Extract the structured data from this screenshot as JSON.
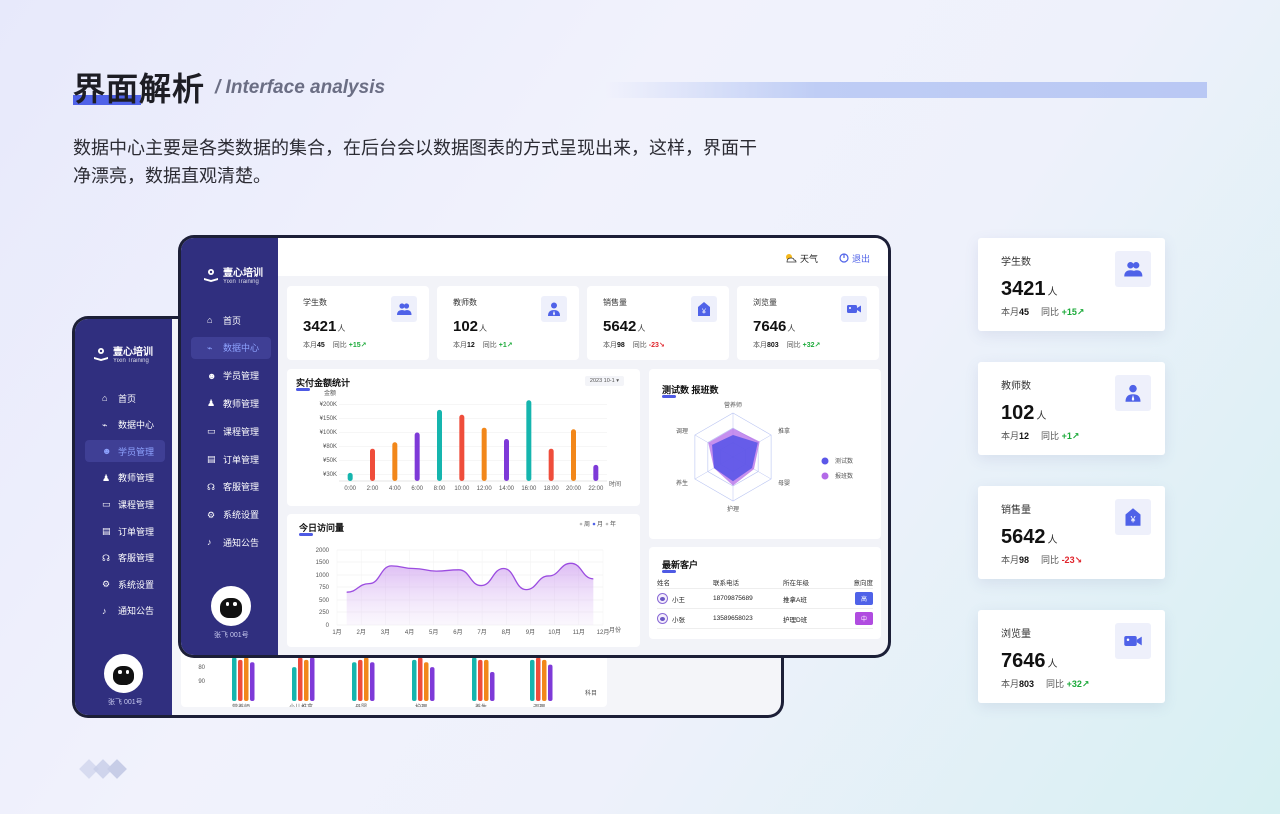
{
  "header": {
    "title": "界面解析",
    "subtitle": "/ Interface analysis",
    "description": "数据中心主要是各类数据的集合，在后台会以数据图表的方式呈现出来，这样，界面干净漂亮，数据直观清楚。"
  },
  "brand": {
    "name": "壹心培训",
    "name_en": "Yixin Training"
  },
  "nav": [
    "首页",
    "数据中心",
    "学员管理",
    "教师管理",
    "课程管理",
    "订单管理",
    "客服管理",
    "系统设置",
    "通知公告"
  ],
  "nav_active_front": 1,
  "nav_active_back": 2,
  "user": {
    "label": "张飞  001号"
  },
  "topbar": {
    "weather": "天气",
    "logout": "退出"
  },
  "metrics": [
    {
      "label": "学生数",
      "value": "3421",
      "unit": "人",
      "month_label": "本月",
      "month": "45",
      "yoy_label": "同比",
      "yoy": "+15",
      "trend": "up",
      "icon": "users-icon"
    },
    {
      "label": "教师数",
      "value": "102",
      "unit": "人",
      "month_label": "本月",
      "month": "12",
      "yoy_label": "同比",
      "yoy": "+1",
      "trend": "up",
      "icon": "teacher-icon"
    },
    {
      "label": "销售量",
      "value": "5642",
      "unit": "人",
      "month_label": "本月",
      "month": "98",
      "yoy_label": "同比",
      "yoy": "-23",
      "trend": "down",
      "icon": "sales-tag-icon"
    },
    {
      "label": "浏览量",
      "value": "7646",
      "unit": "人",
      "month_label": "本月",
      "month": "803",
      "yoy_label": "同比",
      "yoy": "+32",
      "trend": "up",
      "icon": "video-icon"
    }
  ],
  "colors": {
    "sidebar": "#302f7f",
    "accent": "#4f62e8",
    "up": "#1caa3a",
    "down": "#e0252c",
    "purple": "#9b4ce0"
  },
  "chart_data": [
    {
      "type": "bar",
      "title": "实付金额统计",
      "date_select": "2023 10-1",
      "ylabel": "金额",
      "xlabel": "时间",
      "yticks": [
        "¥30K",
        "¥50K",
        "¥80K",
        "¥100K",
        "¥150K",
        "¥200K"
      ],
      "categories": [
        "0:00",
        "2:00",
        "4:00",
        "6:00",
        "8:00",
        "10:00",
        "12:00",
        "14:00",
        "16:00",
        "18:00",
        "20:00",
        "22:00"
      ],
      "values": [
        0.5,
        2.0,
        2.4,
        3.0,
        4.4,
        4.1,
        3.3,
        2.6,
        5.0,
        2.0,
        3.2,
        1.0
      ],
      "bar_colors": [
        "#15b5ae",
        "#ef4d3b",
        "#f2871a",
        "#7e3ad8",
        "#15b5ae",
        "#ef4d3b",
        "#f2871a",
        "#7e3ad8",
        "#15b5ae",
        "#ef4d3b",
        "#f2871a",
        "#7e3ad8"
      ],
      "grid": true
    },
    {
      "type": "radar",
      "title": "测试数 报班数",
      "axes": [
        "营养师",
        "推拿",
        "母婴",
        "护理",
        "养生",
        "调理"
      ],
      "series": [
        {
          "name": "测试数",
          "values": [
            0.5,
            0.65,
            0.5,
            0.55,
            0.5,
            0.55
          ],
          "color": "#5b57e8"
        },
        {
          "name": "报班数",
          "values": [
            0.65,
            0.7,
            0.55,
            0.65,
            0.5,
            0.65
          ],
          "color": "#b36be8"
        }
      ]
    },
    {
      "type": "area",
      "title": "今日访问量",
      "legend": [
        "周",
        "月",
        "年"
      ],
      "legend_active": 1,
      "xlabel": "月份",
      "categories": [
        "1月",
        "2月",
        "3月",
        "4月",
        "5月",
        "6月",
        "7月",
        "8月",
        "9月",
        "10月",
        "11月",
        "12月"
      ],
      "yticks": [
        0,
        250,
        500,
        750,
        1000,
        1500,
        2000
      ],
      "values": [
        650,
        820,
        1350,
        1250,
        1150,
        1200,
        780,
        1250,
        700,
        980,
        1450,
        920
      ],
      "grid": true
    },
    {
      "type": "bar",
      "title": "",
      "xlabel": "科目",
      "yticks": [
        80,
        90
      ],
      "categories": [
        "营养师",
        "小儿推拿",
        "母婴",
        "护理",
        "养生",
        "调理"
      ],
      "series": [
        {
          "values": [
            96,
            92,
            94,
            95,
            96,
            95
          ],
          "color": "#15b5ae"
        },
        {
          "values": [
            95,
            96,
            95,
            96,
            95,
            96
          ],
          "color": "#ef4d3b"
        },
        {
          "values": [
            96,
            95,
            96,
            94,
            95,
            95
          ],
          "color": "#f2871a"
        },
        {
          "values": [
            94,
            96,
            94,
            92,
            90,
            93
          ],
          "color": "#7e3ad8"
        }
      ]
    }
  ],
  "customers": {
    "title": "最新客户",
    "headers": [
      "姓名",
      "联系电话",
      "所在年级",
      "意向度"
    ],
    "rows": [
      {
        "name": "小王",
        "phone": "18709875689",
        "grade": "推拿A班",
        "intent": "高",
        "color": "#4f62e8"
      },
      {
        "name": "小张",
        "phone": "13589658023",
        "grade": "护理D班",
        "intent": "中",
        "color": "#b04ce0"
      }
    ]
  }
}
